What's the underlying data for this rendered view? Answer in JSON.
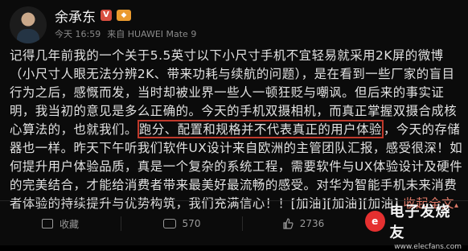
{
  "post": {
    "author": "余承东",
    "badges": {
      "v": "V",
      "level": ""
    },
    "time": "今天 16:59",
    "source": "来自 HUAWEI Mate 9",
    "content_lines": [
      [
        "记得几年前我的一个关于5.5英寸以下小尺寸手机不宜轻易就采用2K屏的微博"
      ],
      [
        "（小尺寸人眼无法分辨2K、带来功耗与续航的问题），是在看到一些厂家的盲目"
      ],
      [
        "行为之后，感慨而发，当时却被业界一些人一顿狂贬与嘲讽。但后来的事实证"
      ],
      [
        "明，我当初的意见是多么正确的。今天的手机双摄相机，而真正掌握双摄合成核"
      ],
      [
        "心算法的，也就我们。",
        "跑分、配置和规格并不代表真正的用户体验",
        "，今天的存储"
      ],
      [
        "器也一样。昨天下午听我们软件UX设计来自欧洲的主管团队汇报，感受很深！如"
      ],
      [
        "何提升用户体验品质，真是一个复杂的系统工程，需要软件与UX体验设计及硬件"
      ],
      [
        "的完美结合，才能给消费者带来最美好最流畅的感受。对华为智能手机未来消费"
      ],
      [
        "者体验的持续提升与优势构筑，我们充满信心！！[加油][加油][加油]",
        "收起全文"
      ]
    ]
  },
  "actions": {
    "share_label": "收藏",
    "comment_count": "570",
    "like_count": "2736"
  },
  "watermark": {
    "circle_text": "e",
    "title": "电子发烧友",
    "url": "www.elecfans.com"
  },
  "colors": {
    "background": "#0b0b0b",
    "highlight_border": "#c0392b",
    "fold_link": "#e07b6a",
    "verified_badge": "#d84e3f"
  }
}
